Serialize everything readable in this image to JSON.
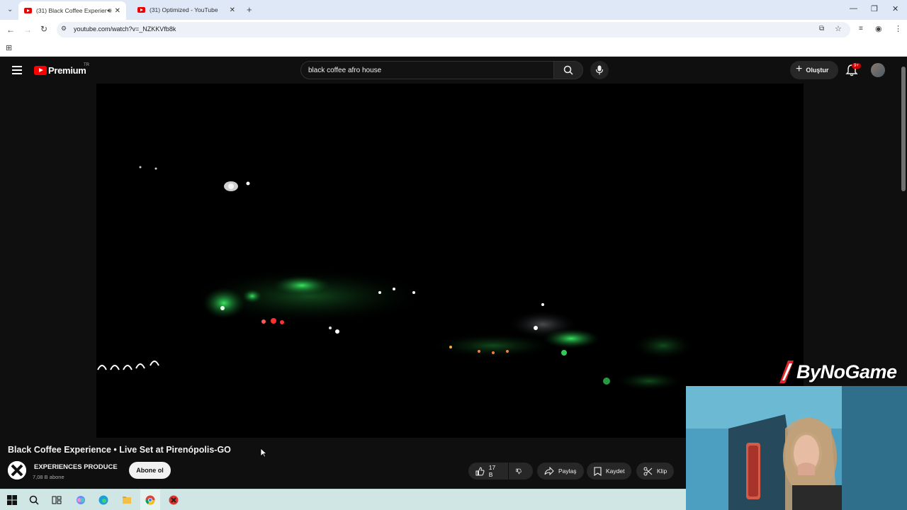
{
  "browser": {
    "tabs": [
      {
        "title": "(31) Black Coffee Experienc",
        "active": true,
        "audio": true
      },
      {
        "title": "(31) Optimized - YouTube",
        "active": false
      }
    ],
    "new_tab": "+",
    "url": "youtube.com/watch?v=_NZKKVfb8k"
  },
  "youtube": {
    "logo_text": "Premium",
    "country": "TR",
    "search_value": "black coffee afro house",
    "create_label": "Oluştur",
    "notif_count": "9+"
  },
  "video": {
    "title": "Black Coffee Experience • Live Set at Pirenópolis-GO",
    "channel": "EXPERIENCES PRODUCE",
    "subscribers": "7,08 B abone",
    "subscribe_label": "Abone ol",
    "likes": "17 B",
    "share_label": "Paylaş",
    "save_label": "Kaydet",
    "clip_label": "Klip"
  },
  "overlay": {
    "streamer_brand": "ByNoGame"
  },
  "colors": {
    "yt_red": "#ff0000",
    "bg": "#0f0f0f",
    "taskbar": "#cfe6e4"
  }
}
